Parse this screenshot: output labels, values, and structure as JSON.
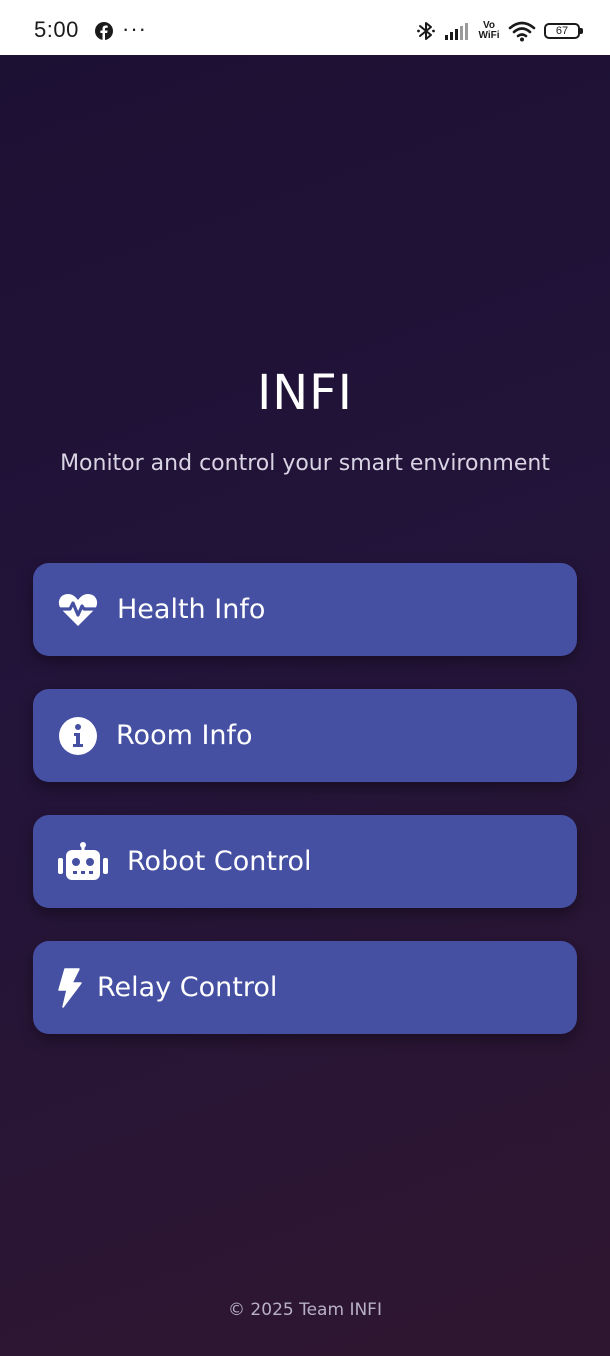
{
  "status_bar": {
    "time": "5:00",
    "more": "···",
    "network_label": "Vo\nWiFi",
    "battery": "67"
  },
  "app": {
    "title": "INFI",
    "subtitle": "Monitor and control your smart environment",
    "menu": [
      {
        "label": "Health Info",
        "icon": "heartbeat-icon"
      },
      {
        "label": "Room Info",
        "icon": "info-circle-icon"
      },
      {
        "label": "Robot Control",
        "icon": "robot-icon"
      },
      {
        "label": "Relay Control",
        "icon": "bolt-icon"
      }
    ],
    "footer": "© 2025 Team INFI"
  },
  "colors": {
    "button_bg": "#4550a2",
    "background_top": "#1c1033",
    "background_bottom": "#2f1630",
    "text": "#ffffff",
    "subtitle_text": "#d9d4e4",
    "footer_text": "#b8b0c6"
  }
}
